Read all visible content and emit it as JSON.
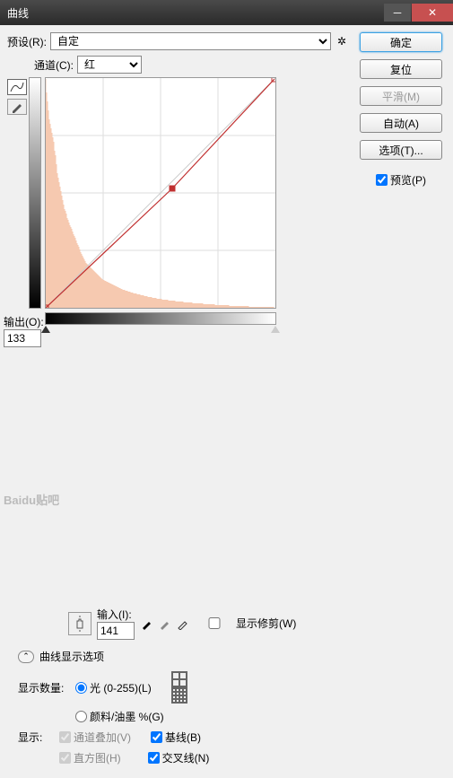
{
  "title": "曲线",
  "preset": {
    "label": "预设(R):",
    "value": "自定"
  },
  "channel": {
    "label": "通道(C):",
    "value": "红"
  },
  "output": {
    "label": "输出(O):",
    "value": "133"
  },
  "input": {
    "label": "输入(I):",
    "value": "141"
  },
  "show_clip": "显示修剪(W)",
  "disclosure": "曲线显示选项",
  "show_amount": {
    "label": "显示数量:",
    "opt_light": "光 (0-255)(L)",
    "opt_ink": "颜料/油墨 %(G)"
  },
  "show": {
    "label": "显示:",
    "channel_overlay": "通道叠加(V)",
    "baseline": "基线(B)",
    "histogram": "直方图(H)",
    "intersection": "交叉线(N)"
  },
  "buttons": {
    "ok": "确定",
    "reset": "复位",
    "smooth": "平滑(M)",
    "auto": "自动(A)",
    "options": "选项(T)...",
    "preview": "预览(P)"
  },
  "watermark": "Baidu贴吧",
  "chart_data": {
    "type": "line",
    "title": "",
    "xlim": [
      0,
      255
    ],
    "ylim": [
      0,
      255
    ],
    "curve_points": [
      {
        "x": 0,
        "y": 0
      },
      {
        "x": 141,
        "y": 133
      },
      {
        "x": 255,
        "y": 255
      }
    ],
    "histogram": [
      255,
      240,
      230,
      220,
      210,
      205,
      200,
      195,
      190,
      185,
      175,
      170,
      160,
      150,
      145,
      140,
      135,
      130,
      125,
      120,
      115,
      110,
      108,
      105,
      100,
      98,
      95,
      92,
      90,
      88,
      85,
      82,
      80,
      78,
      75,
      72,
      70,
      68,
      65,
      62,
      60,
      58,
      56,
      54,
      52,
      50,
      49,
      48,
      47,
      46,
      45,
      44,
      43,
      42,
      41,
      40,
      39,
      38,
      37,
      36,
      35,
      34,
      33,
      32,
      31,
      31,
      30,
      30,
      29,
      29,
      28,
      28,
      27,
      27,
      26,
      26,
      25,
      25,
      24,
      24,
      23,
      23,
      22,
      22,
      21,
      21,
      20,
      20,
      20,
      19,
      19,
      19,
      18,
      18,
      18,
      17,
      17,
      17,
      16,
      16,
      16,
      16,
      15,
      15,
      15,
      15,
      14,
      14,
      14,
      14,
      13,
      13,
      13,
      13,
      12,
      12,
      12,
      12,
      12,
      11,
      11,
      11,
      11,
      11,
      10,
      10,
      10,
      10,
      10,
      10,
      9,
      9,
      9,
      9,
      9,
      9,
      9,
      8,
      8,
      8,
      8,
      8,
      8,
      8,
      8,
      7,
      7,
      7,
      7,
      7,
      7,
      7,
      7,
      7,
      6,
      6,
      6,
      6,
      6,
      6,
      6,
      6,
      6,
      6,
      5,
      5,
      5,
      5,
      5,
      5,
      5,
      5,
      5,
      5,
      5,
      5,
      4,
      4,
      4,
      4,
      4,
      4,
      4,
      4,
      4,
      4,
      4,
      4,
      4,
      3,
      3,
      3,
      3,
      3,
      3,
      3,
      3,
      3,
      3,
      3,
      3,
      3,
      3,
      3,
      3,
      2,
      2,
      2,
      2,
      2,
      2,
      2,
      2,
      2,
      2,
      2,
      2,
      2,
      2,
      2,
      2,
      2,
      2,
      2,
      2,
      2,
      2,
      1,
      1,
      1,
      1,
      1,
      1,
      1,
      1,
      1,
      1,
      1,
      1,
      1,
      1,
      1,
      1,
      1,
      1,
      1,
      1,
      1,
      1,
      1,
      1,
      1,
      1,
      1,
      1,
      0
    ]
  }
}
